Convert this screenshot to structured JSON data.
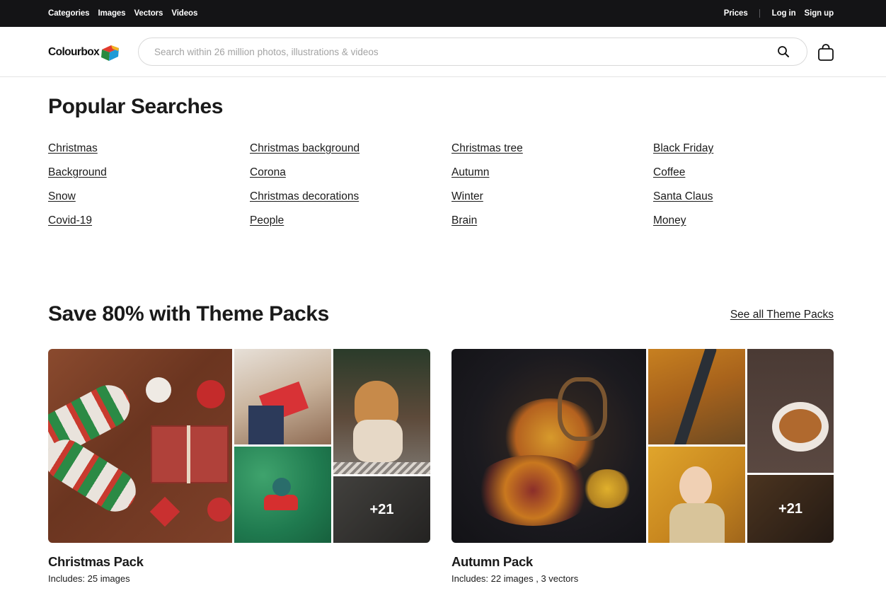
{
  "topbar": {
    "nav": [
      "Categories",
      "Images",
      "Vectors",
      "Videos"
    ],
    "prices": "Prices",
    "login": "Log in",
    "signup": "Sign up"
  },
  "header": {
    "logo_text": "Colourbox",
    "search_placeholder": "Search within 26 million photos, illustrations & videos",
    "search_icon": "search-icon",
    "cart_icon": "shopping-bag-icon"
  },
  "popular": {
    "title": "Popular Searches",
    "columns": [
      [
        "Christmas",
        "Background",
        "Snow",
        "Covid-19"
      ],
      [
        "Christmas background",
        "Corona",
        "Christmas decorations",
        "People"
      ],
      [
        "Christmas tree",
        "Autumn",
        "Winter",
        "Brain"
      ],
      [
        "Black Friday",
        "Coffee",
        "Santa Claus",
        "Money"
      ]
    ]
  },
  "packs": {
    "title": "Save 80% with Theme Packs",
    "see_all": "See all Theme Packs",
    "items": [
      {
        "name": "Christmas Pack",
        "includes": "Includes: 25 images",
        "more": "+21",
        "colors": [
          "#7a3f28",
          "#c9a788",
          "#a5734c",
          "#2f7d5a",
          "#3b3534"
        ]
      },
      {
        "name": "Autumn Pack",
        "includes": "Includes: 22 images , 3 vectors",
        "more": "+21",
        "colors": [
          "#1e1c22",
          "#b97728",
          "#4a3c36",
          "#d89a35",
          "#3a2a20"
        ]
      }
    ]
  },
  "colors": {
    "topbar_bg": "#141416",
    "text": "#1a1a1a"
  }
}
